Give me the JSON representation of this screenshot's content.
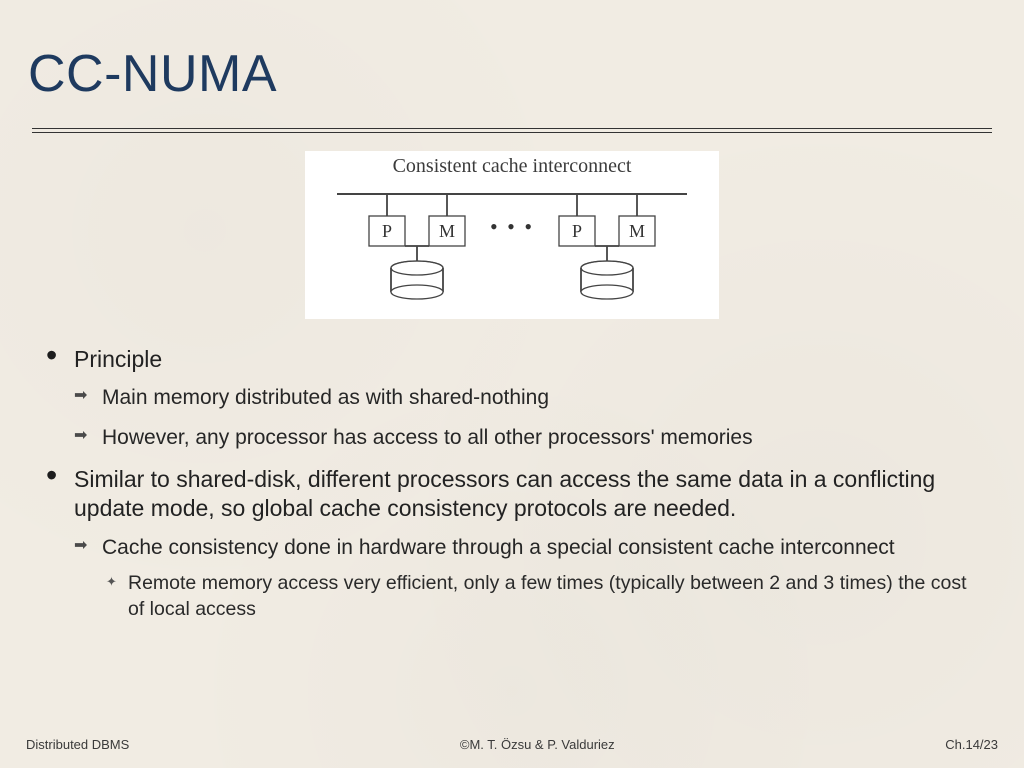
{
  "title": "CC-NUMA",
  "diagram": {
    "label": "Consistent cache interconnect",
    "node_p": "P",
    "node_m": "M",
    "dots": "• • •"
  },
  "bullets": {
    "b1": {
      "text": "Principle",
      "sub": [
        "Main memory distributed as with shared-nothing",
        "However, any processor has access to all other processors' memories"
      ]
    },
    "b2": {
      "text": "Similar to shared-disk, different processors can access the same data in a conflicting update mode, so global cache consistency protocols are needed.",
      "sub1": "Cache consistency done in hardware through a special consistent cache interconnect",
      "subsub1": "Remote memory access very efficient, only a few times (typically between 2 and 3 times) the cost of local access"
    }
  },
  "footer": {
    "left": "Distributed DBMS",
    "center": "©M. T. Özsu & P. Valduriez",
    "right": "Ch.14/23"
  }
}
